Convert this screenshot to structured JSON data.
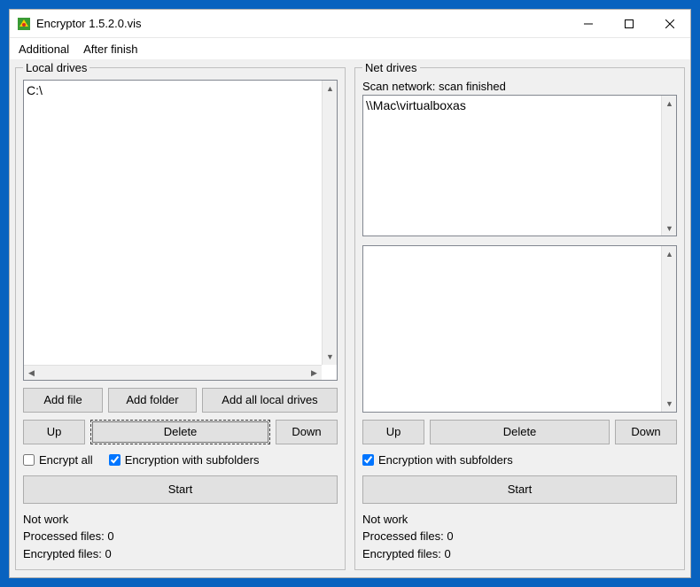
{
  "window": {
    "title": "Encryptor 1.5.2.0.vis"
  },
  "menu": {
    "additional": "Additional",
    "after_finish": "After finish"
  },
  "local": {
    "legend": "Local drives",
    "items": [
      "C:\\"
    ],
    "add_file": "Add file",
    "add_folder": "Add folder",
    "add_all": "Add all local drives",
    "up": "Up",
    "delete": "Delete",
    "down": "Down",
    "encrypt_all": "Encrypt all",
    "encrypt_all_checked": false,
    "encrypt_subfolders": "Encryption with subfolders",
    "encrypt_subfolders_checked": true,
    "start": "Start",
    "status_not_work": "Not work",
    "status_processed": "Processed files: 0",
    "status_encrypted": "Encrypted files: 0"
  },
  "net": {
    "legend": "Net drives",
    "scan_status": "Scan network: scan finished",
    "items_top": [
      "\\\\Mac\\virtualboxas"
    ],
    "items_bottom": [],
    "up": "Up",
    "delete": "Delete",
    "down": "Down",
    "encrypt_subfolders": "Encryption with subfolders",
    "encrypt_subfolders_checked": true,
    "start": "Start",
    "status_not_work": "Not work",
    "status_processed": "Processed files: 0",
    "status_encrypted": "Encrypted files: 0"
  }
}
